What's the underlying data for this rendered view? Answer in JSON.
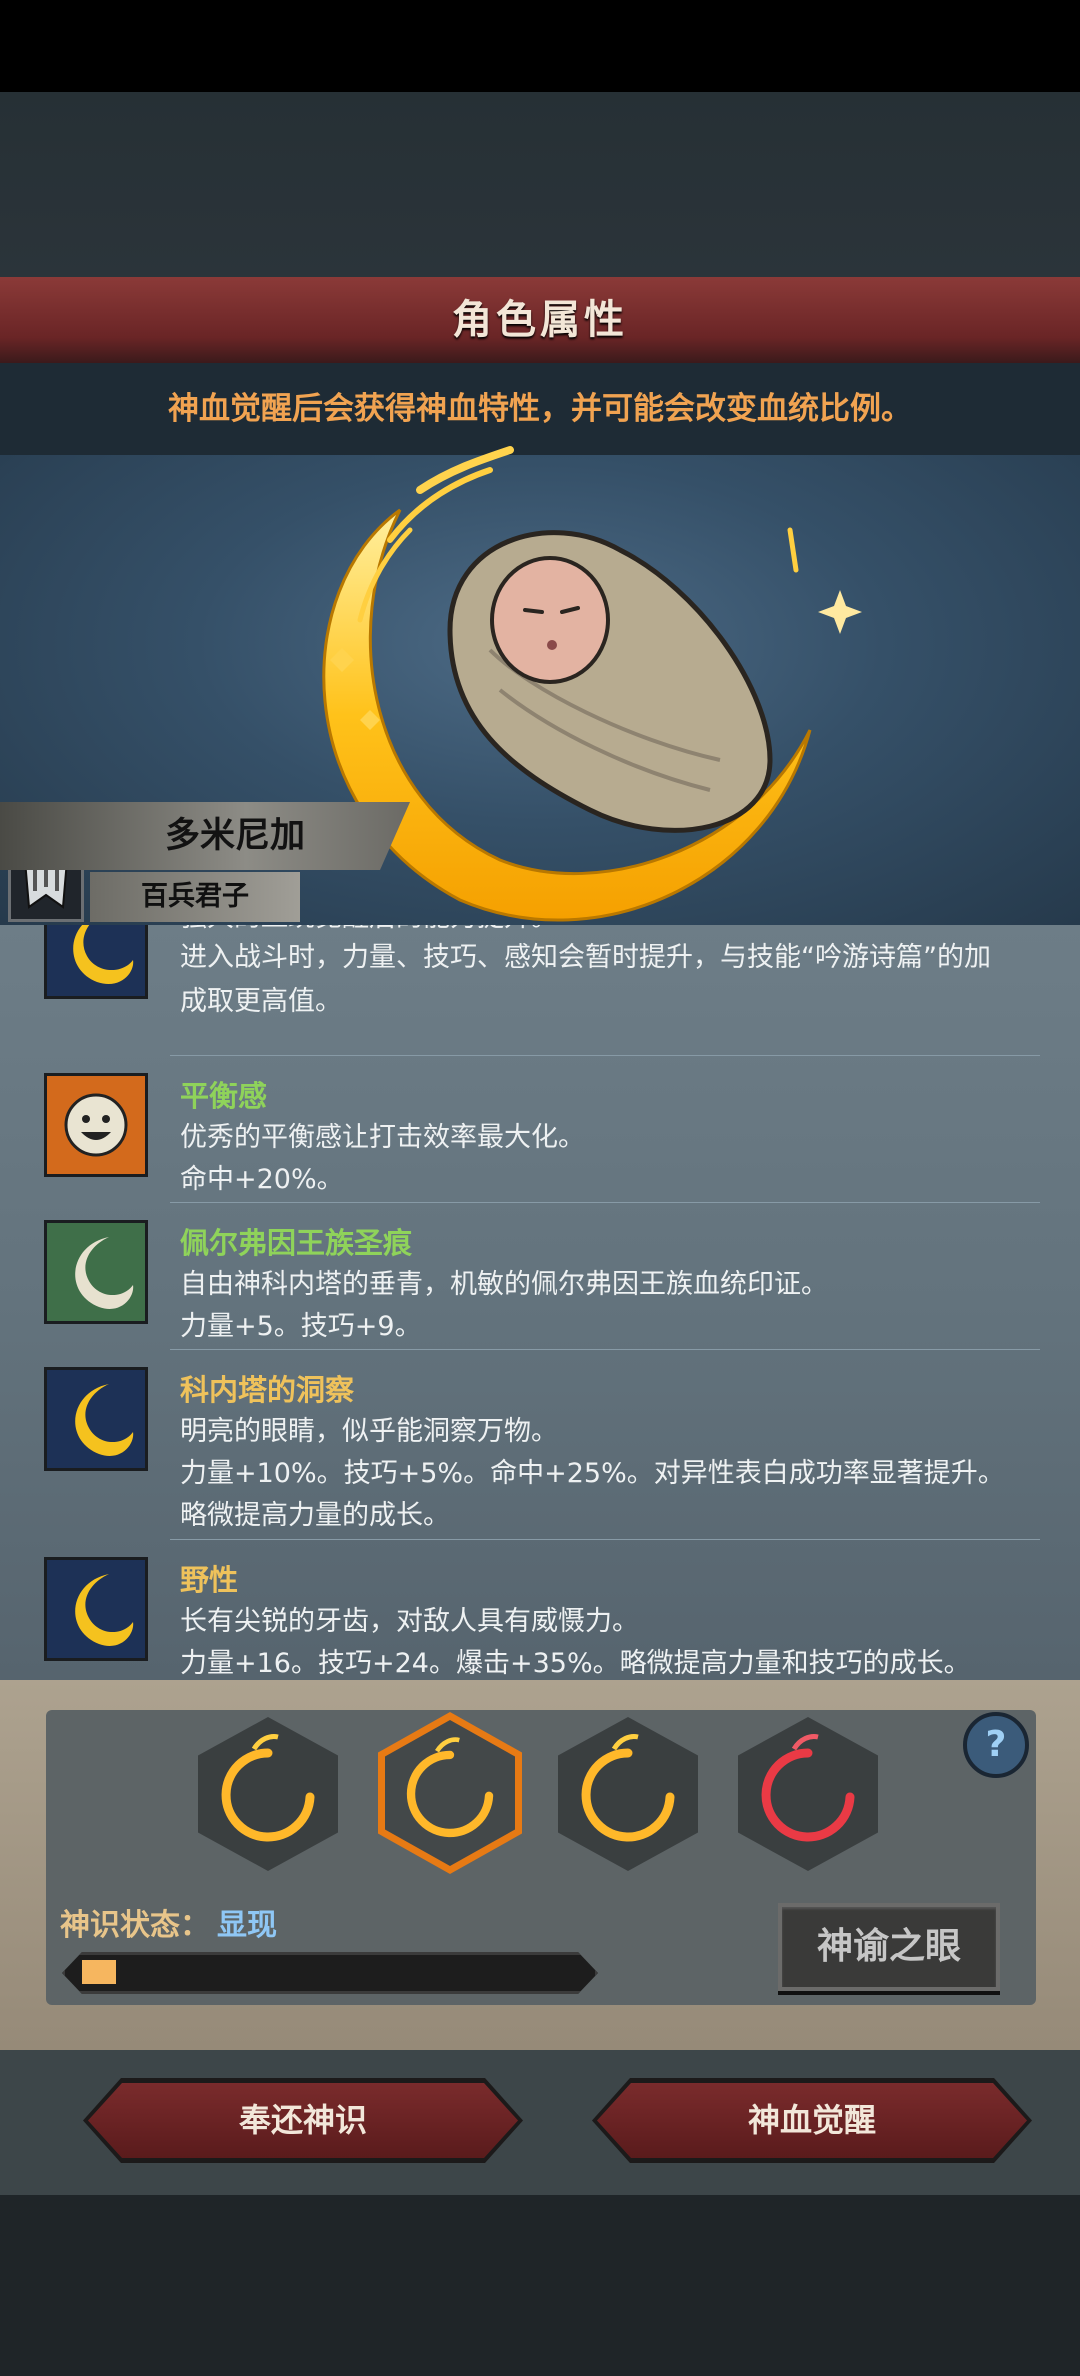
{
  "header": {
    "title": "角色属性",
    "hint": "神血觉醒后会获得神血特性，并可能会改变血统比例。"
  },
  "character": {
    "name": "多米尼加",
    "subtitle": "百兵君子"
  },
  "traits": [
    {
      "name": "",
      "lines": [
        "强大的血统觉醒后的能力提升。",
        "进入战斗时，力量、技巧、感知会暂时提升，与技能“吟游诗篇”的加",
        "成取更高值。"
      ],
      "icon": "golden-crescent-icon"
    },
    {
      "name": "平衡感",
      "lines": [
        "优秀的平衡感让打击效率最大化。",
        "命中+20%。"
      ],
      "name_color": "#8fd35a",
      "icon": "smiling-sun-icon"
    },
    {
      "name": "佩尔弗因王族圣痕",
      "lines": [
        "自由神科内塔的垂青，机敏的佩尔弗因王族血统印证。",
        "力量+5。技巧+9。"
      ],
      "name_color": "#8fd35a",
      "icon": "white-crescent-icon"
    },
    {
      "name": "科内塔的洞察",
      "lines": [
        "明亮的眼睛，似乎能洞察万物。",
        "力量+10%。技巧+5%。命中+25%。对异性表白成功率显著提升。",
        "略微提高力量的成长。"
      ],
      "name_color": "#efc25b",
      "icon": "golden-crescent-icon"
    },
    {
      "name": "野性",
      "lines": [
        "长有尖锐的牙齿，对敌人具有威慑力。",
        "力量+16。技巧+24。爆击+35%。略微提高力量和技巧的成长。"
      ],
      "name_color": "#efc25b",
      "icon": "golden-crescent-icon"
    }
  ],
  "divine_slots": [
    {
      "color": "gold",
      "icon": "golden-crescent-icon",
      "selected": false
    },
    {
      "color": "gold",
      "icon": "golden-crescent-icon",
      "selected": true
    },
    {
      "color": "gold",
      "icon": "golden-crescent-icon",
      "selected": false
    },
    {
      "color": "red",
      "icon": "red-crescent-icon",
      "selected": false
    }
  ],
  "status": {
    "label": "神识状态：",
    "value": "显现",
    "progress": 0.07
  },
  "buttons": {
    "oracle": "神谕之眼",
    "return": "奉还神识",
    "awaken": "神血觉醒",
    "help": "?"
  },
  "colors": {
    "accent_gold": "#f6b65f",
    "hint_orange": "#f1a351",
    "title_red": "#7a2b2c"
  }
}
